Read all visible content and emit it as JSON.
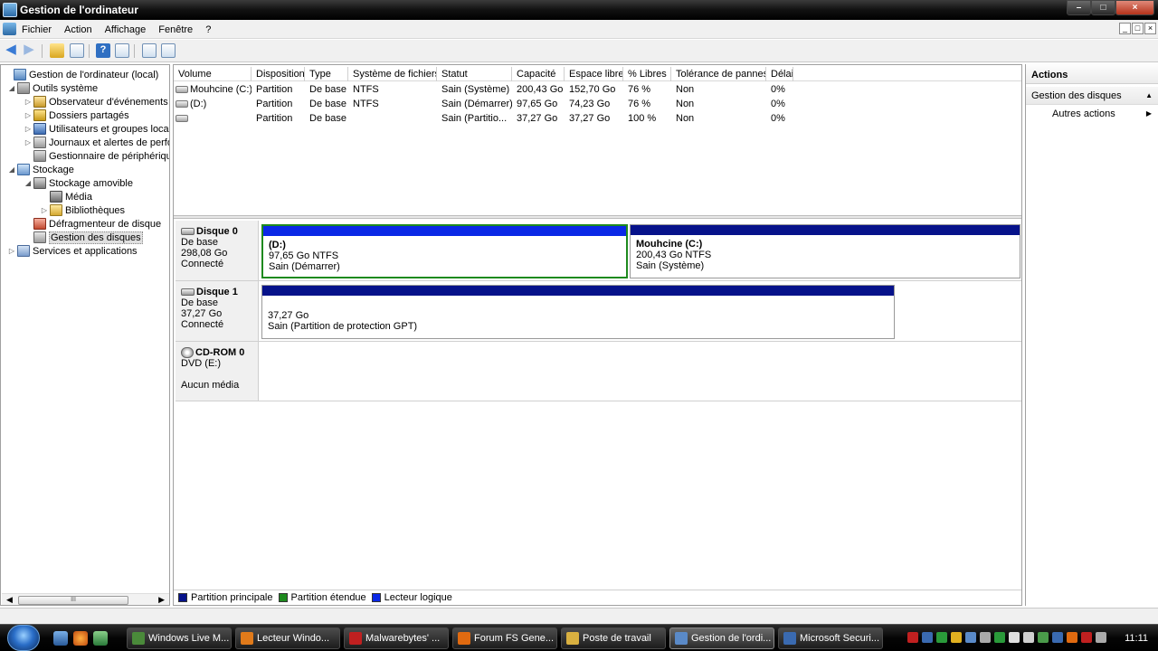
{
  "window": {
    "title": "Gestion de l'ordinateur",
    "controls": [
      "minimize-icon",
      "maximize-icon",
      "close-icon"
    ]
  },
  "menu": {
    "items": [
      "Fichier",
      "Action",
      "Affichage",
      "Fenêtre",
      "?"
    ],
    "mdi_controls": [
      "_",
      "□",
      "×"
    ]
  },
  "toolbar": {
    "icons": [
      "back-arrow-icon",
      "forward-arrow-icon",
      "up-folder-icon",
      "show-hide-tree-icon",
      "help-icon",
      "properties-icon",
      "refresh-icon",
      "export-icon"
    ]
  },
  "tree": {
    "items": [
      {
        "label": "Gestion de l'ordinateur (local)",
        "icon": "computer-icon"
      },
      {
        "label": "Outils système",
        "icon": "tools-icon"
      },
      {
        "label": "Observateur d'événements",
        "icon": "event-viewer-icon"
      },
      {
        "label": "Dossiers partagés",
        "icon": "shared-folders-icon"
      },
      {
        "label": "Utilisateurs et groupes locau",
        "icon": "users-icon"
      },
      {
        "label": "Journaux et alertes de perfo",
        "icon": "performance-logs-icon"
      },
      {
        "label": "Gestionnaire de périphérique",
        "icon": "device-manager-icon"
      },
      {
        "label": "Stockage",
        "icon": "storage-icon"
      },
      {
        "label": "Stockage amovible",
        "icon": "removable-storage-icon"
      },
      {
        "label": "Média",
        "icon": "media-icon"
      },
      {
        "label": "Bibliothèques",
        "icon": "libraries-icon"
      },
      {
        "label": "Défragmenteur de disque",
        "icon": "defragmenter-icon"
      },
      {
        "label": "Gestion des disques",
        "icon": "disk-management-icon",
        "selected": true
      },
      {
        "label": "Services et applications",
        "icon": "services-icon"
      }
    ],
    "scroll_thumb_glyph": "III"
  },
  "volumes": {
    "columns": [
      "Volume",
      "Disposition",
      "Type",
      "Système de fichiers",
      "Statut",
      "Capacité",
      "Espace libre",
      "% Libres",
      "Tolérance de pannes",
      "Délai"
    ],
    "rows": [
      [
        "Mouhcine (C:)",
        "Partition",
        "De base",
        "NTFS",
        "Sain (Système)",
        "200,43 Go",
        "152,70 Go",
        "76 %",
        "Non",
        "0%"
      ],
      [
        "(D:)",
        "Partition",
        "De base",
        "NTFS",
        "Sain (Démarrer)",
        "97,65 Go",
        "74,23 Go",
        "76 %",
        "Non",
        "0%"
      ],
      [
        "",
        "Partition",
        "De base",
        "",
        "Sain (Partitio...",
        "37,27 Go",
        "37,27 Go",
        "100 %",
        "Non",
        "0%"
      ]
    ]
  },
  "disks": [
    {
      "name": "Disque 0",
      "type": "De base",
      "size": "298,08 Go",
      "status": "Connecté",
      "partitions": [
        {
          "name": "(D:)",
          "size": "97,65 Go NTFS",
          "state": "Sain (Démarrer)",
          "bar_color": "#0a28e6",
          "selected": true
        },
        {
          "name": "Mouhcine  (C:)",
          "size": "200,43 Go NTFS",
          "state": "Sain (Système)",
          "bar_color": "#06128a"
        }
      ]
    },
    {
      "name": "Disque 1",
      "type": "De base",
      "size": "37,27 Go",
      "status": "Connecté",
      "partitions": [
        {
          "name": "",
          "size": "37,27 Go",
          "state": "Sain (Partition de protection GPT)",
          "bar_color": "#06128a"
        }
      ]
    },
    {
      "name": "CD-ROM 0",
      "type": "DVD (E:)",
      "size": "",
      "status": "Aucun média",
      "partitions": []
    }
  ],
  "legend": [
    {
      "label": "Partition principale",
      "color": "#06128a"
    },
    {
      "label": "Partition étendue",
      "color": "#1e8a1e"
    },
    {
      "label": "Lecteur logique",
      "color": "#0a28e6"
    }
  ],
  "actions": {
    "title": "Actions",
    "section": "Gestion des disques",
    "items": [
      "Autres actions"
    ]
  },
  "taskbar": {
    "quick_launch": [
      "show-desktop-icon",
      "firefox-icon",
      "messenger-icon"
    ],
    "tasks": [
      {
        "label": "Windows Live M...",
        "icon_color": "#4a8a3a"
      },
      {
        "label": "Lecteur Windo...",
        "icon_color": "#e07a1a"
      },
      {
        "label": "Malwarebytes' ...",
        "icon_color": "#c02020"
      },
      {
        "label": "Forum FS Gene...",
        "icon_color": "#e06a10"
      },
      {
        "label": "Poste de travail",
        "icon_color": "#d9b040"
      },
      {
        "label": "Gestion de l'ordi...",
        "icon_color": "#5a8ac8",
        "active": true
      },
      {
        "label": "Microsoft Securi...",
        "icon_color": "#3a6ab0"
      }
    ],
    "clock": "11:11"
  }
}
